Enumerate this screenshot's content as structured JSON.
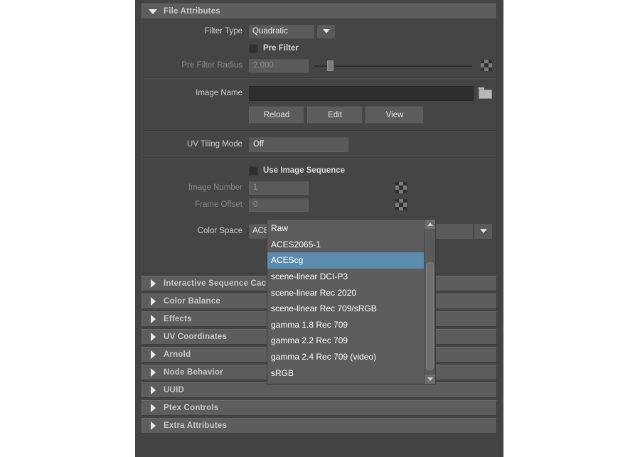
{
  "panel": {
    "section_title": "File Attributes",
    "rows": {
      "filter_type_label": "Filter Type",
      "filter_type_value": "Quadratic",
      "pre_filter_label": "Pre Filter",
      "pre_filter_radius_label": "Pre Filter Radius",
      "pre_filter_radius_value": "2.000",
      "image_name_label": "Image Name",
      "image_name_value": "",
      "uv_tiling_label": "UV Tiling Mode",
      "uv_tiling_value": "Off",
      "use_image_sequence_label": "Use Image Sequence",
      "image_number_label": "Image Number",
      "image_number_value": "1",
      "frame_offset_label": "Frame Offset",
      "frame_offset_value": "0",
      "color_space_label": "Color Space",
      "color_space_value": "ACEScg"
    },
    "buttons": {
      "reload": "Reload",
      "edit": "Edit",
      "view": "View"
    },
    "collapsed_sections": [
      "Interactive Sequence Caching",
      "Color Balance",
      "Effects",
      "UV Coordinates",
      "Arnold",
      "Node Behavior",
      "UUID",
      "Ptex Controls",
      "Extra Attributes"
    ]
  },
  "dropdown": {
    "selected": "ACEScg",
    "items": [
      "Raw",
      "ACES2065-1",
      "ACEScg",
      "scene-linear DCI-P3",
      "scene-linear Rec 2020",
      "scene-linear Rec 709/sRGB",
      "gamma 1.8 Rec 709",
      "gamma 2.2 Rec 709",
      "gamma 2.4 Rec 709 (video)",
      "sRGB"
    ]
  },
  "colors": {
    "panel_bg": "#444444",
    "header_bg": "#5d5d5d",
    "field_bg": "#5a5a5a",
    "dark_field_bg": "#2e2e2e",
    "highlight": "#5b8cae",
    "text": "#e6e6e6",
    "dim_text": "#8a8a8a"
  }
}
